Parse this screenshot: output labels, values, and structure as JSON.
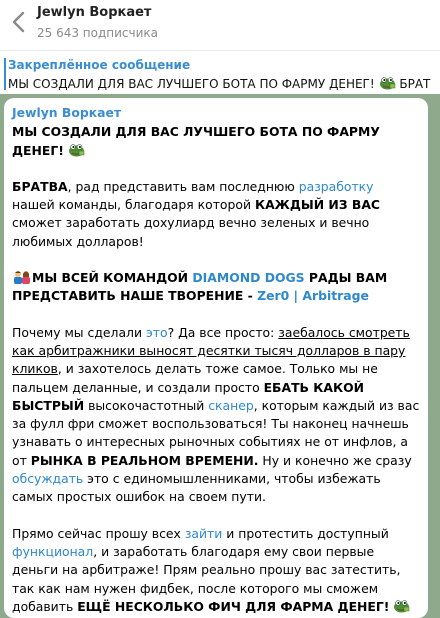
{
  "header": {
    "title": "Jewlyn Bоркает",
    "subscribers": "25 643 подписчика"
  },
  "pinned": {
    "label": "Закреплённое сообщение",
    "text": "МЫ СОЗДАЛИ ДЛЯ ВАС ЛУЧШЕГО БОТА ПО ФАРМУ ДЕНЕГ!",
    "text_after": "БРАТ"
  },
  "message": {
    "sender": "Jewlyn Воркает",
    "title": "МЫ СОЗДАЛИ ДЛЯ ВАС ЛУЧШЕГО БОТА ПО ФАРМУ ДЕНЕГ!",
    "p1": {
      "bratva": "БРАТВА",
      "t1": ", рад представить вам последнюю ",
      "link_razrabotka": "разработку",
      "t2": " нашей команды, благодаря которой ",
      "bold_kazhdy": "КАЖДЫЙ ИЗ ВАС",
      "t3": " сможет заработать дохулиард вечно зеленых и вечно любимых долларов!"
    },
    "p2": {
      "t1": "МЫ ВСЕЙ КОМАНДОЙ ",
      "team": "DIAMOND DOGS",
      "t2": " РАДЫ ВАМ ПРЕДСТАВИТЬ НАШЕ ТВОРЕНИЕ - ",
      "product": "Zer0 | Arbitrage"
    },
    "p3": {
      "t1": "Почему мы сделали ",
      "link_eto": "это",
      "t2": "? Да все просто: ",
      "underline": "заебалось смотреть как арбитражники выносят десятки тысяч долларов в пару кликов",
      "t3": ", и захотелось делать тоже самое. Только мы не пальцем деланные, и создали просто ",
      "bold_ebat": "ЕБАТЬ КАКОЙ БЫСТРЫЙ",
      "t4": " высокочастотный ",
      "link_skaner": "сканер",
      "t5": ", которым каждый из вас за фулл фри сможет воспользоваться! Ты наконец начнешь узнавать о интересных рыночных событиях не от инфлов, а от ",
      "bold_rynka": "РЫНКА В РЕАЛЬНОМ ВРЕМЕНИ.",
      "t6": " Ну и конечно же сразу ",
      "link_obsudat": "обсуждать",
      "t7": " это с единомышленниками, чтобы избежать самых простых ошибок на своем пути."
    },
    "p4": {
      "t1": "Прямо сейчас прошу всех ",
      "link_zaiti": "зайти",
      "t2": " и протестить доступный ",
      "link_funkcional": "функционал",
      "t3": ", и заработать благодаря ему свои первые деньги на арбитраже! Прям реально прошу вас затестить, так как нам нужен фидбек, после которого мы сможем добавить ",
      "bold_esche": "ЕЩЁ НЕСКОЛЬКО ФИЧ ДЛЯ ФАРМА ДЕНЕГ!"
    }
  },
  "colors": {
    "accent": "#3a8ed0",
    "link": "#2d88cc",
    "background": "#8fa98d"
  },
  "icons": [
    "back-arrow-icon",
    "frog-money-emoji-icon",
    "people-couple-emoji-icon"
  ]
}
